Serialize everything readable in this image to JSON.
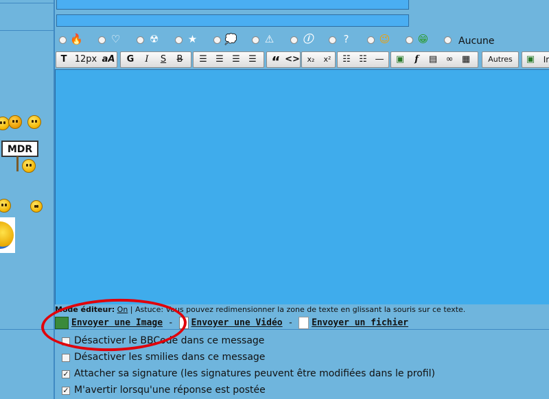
{
  "smilies_left": {
    "mdr_sign": "MDR"
  },
  "radio_row": {
    "icons": [
      "flame-icon",
      "heart-icon",
      "radiation-icon",
      "star-icon",
      "speech-bubble-icon",
      "warning-icon",
      "info-icon",
      "question-icon",
      "wink-icon",
      "grin-icon"
    ],
    "none_label": "Aucune"
  },
  "toolbar": {
    "font_size_label": "12px",
    "case_label": "aA",
    "bold_label": "G",
    "italic_label": "I",
    "underline_label": "S",
    "strike_label": "B",
    "quote_label": "“",
    "code_label": "<>",
    "sub_label": "x₂",
    "sup_label": "x²",
    "others_label": "Autres",
    "last_label": "Ir"
  },
  "editor": {
    "mode_prefix": "Mode éditeur:",
    "mode_value": "On",
    "tip": "| Astuce: Vous pouvez redimensionner la zone de texte en glissant la souris sur ce texte."
  },
  "uploads": {
    "image_label": "Envoyer une Image",
    "video_label": "Envoyer une Vidéo",
    "file_label": "Envoyer un fichier",
    "sep": "-"
  },
  "options": [
    {
      "label": "Désactiver le BBCode dans ce message",
      "checked": false
    },
    {
      "label": "Désactiver les smilies dans ce message",
      "checked": false
    },
    {
      "label": "Attacher sa signature (les signatures peuvent être modifiées dans le profil)",
      "checked": true
    },
    {
      "label": "M'avertir lorsqu'une réponse est postée",
      "checked": true
    }
  ]
}
